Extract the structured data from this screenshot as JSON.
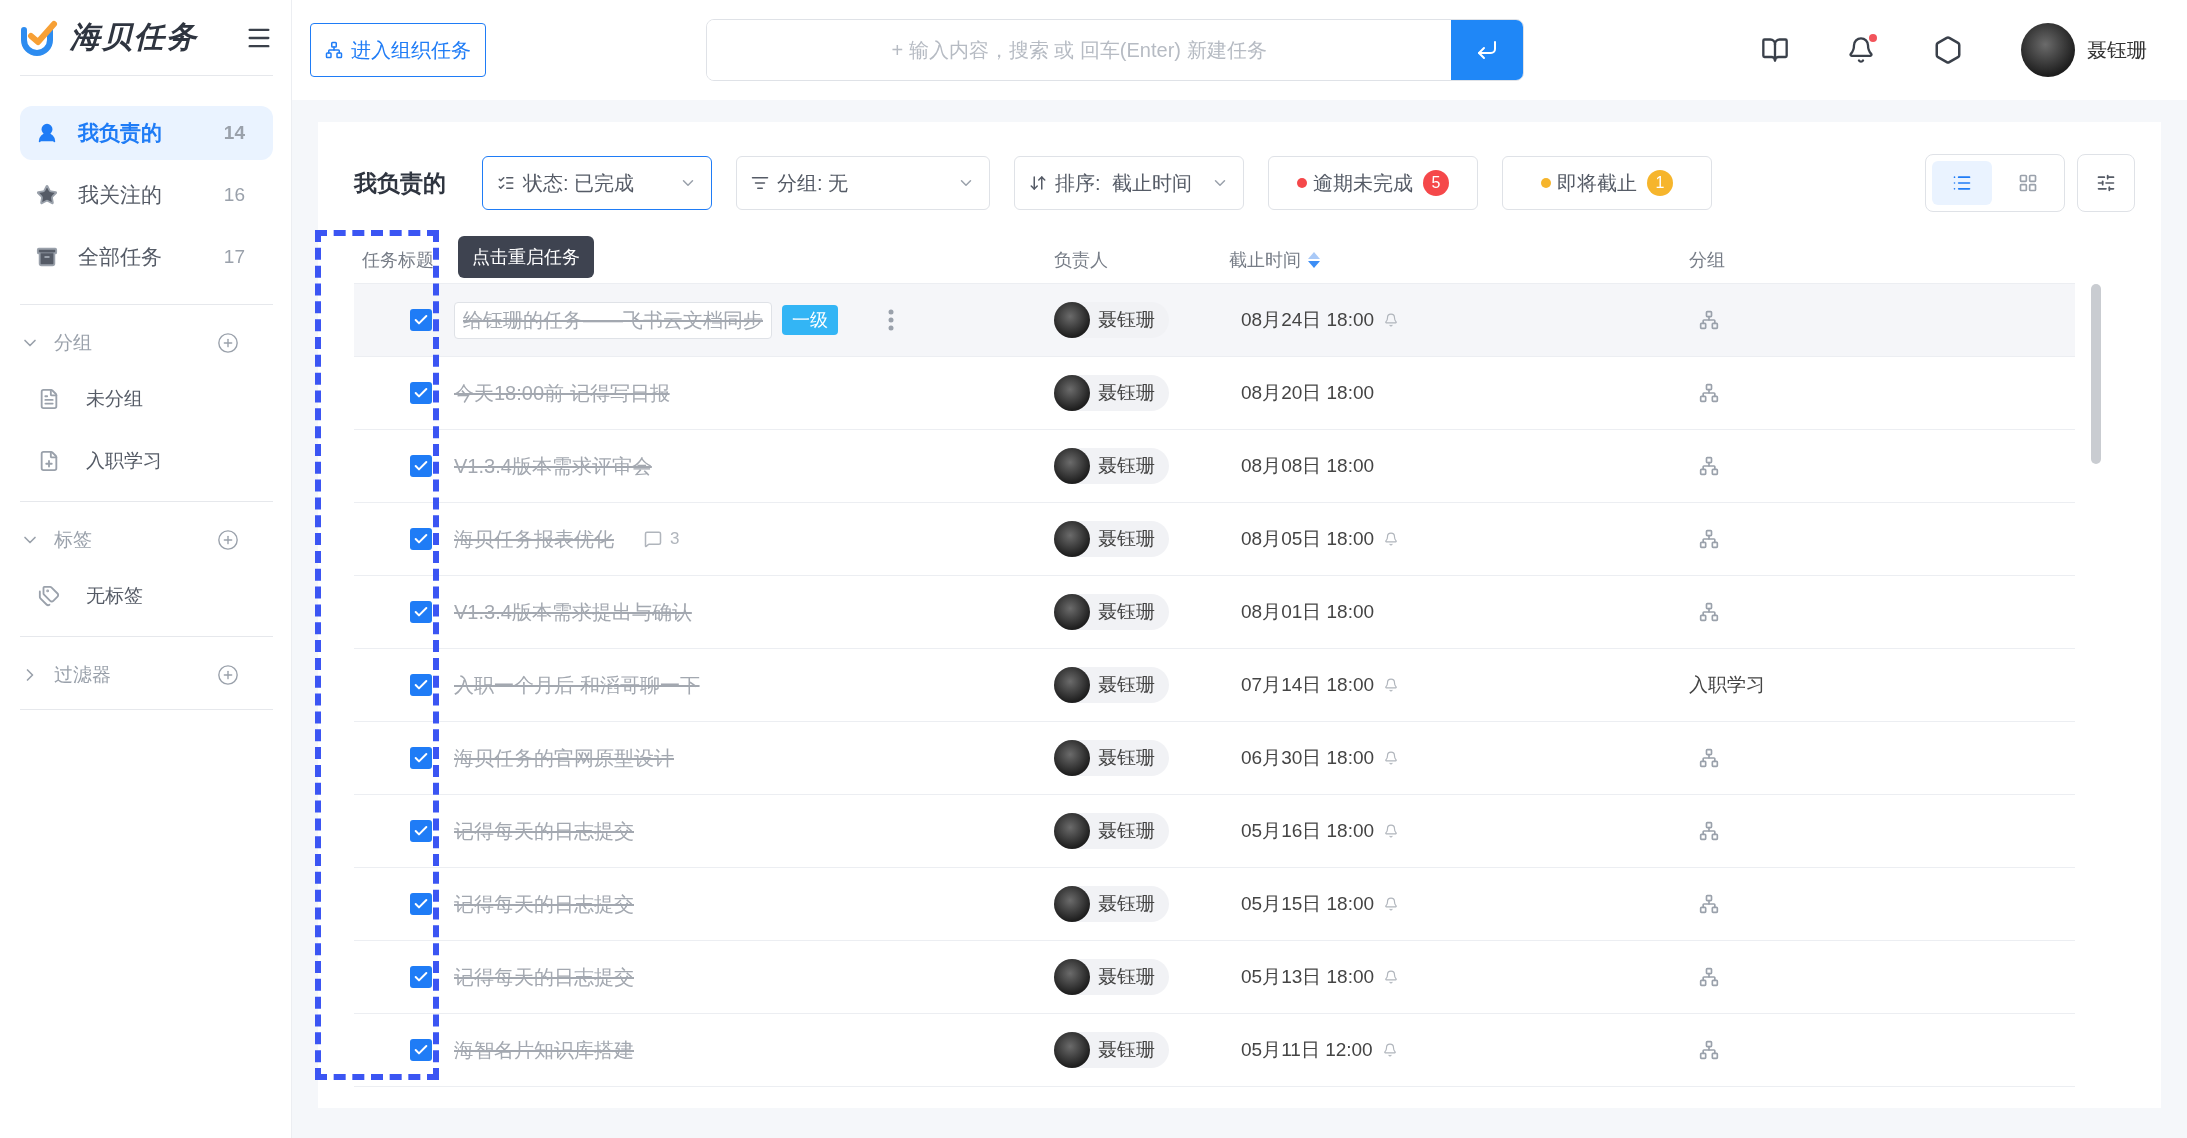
{
  "app": {
    "name": "海贝任务"
  },
  "sidebar": {
    "items": [
      {
        "label": "我负责的",
        "count": "14",
        "selected": true
      },
      {
        "label": "我关注的",
        "count": "16",
        "selected": false
      },
      {
        "label": "全部任务",
        "count": "17",
        "selected": false
      }
    ],
    "sections": [
      {
        "title": "分组",
        "expanded": true,
        "items": [
          "未分组",
          "入职学习"
        ]
      },
      {
        "title": "标签",
        "expanded": true,
        "items": [
          "无标签"
        ]
      },
      {
        "title": "过滤器",
        "expanded": false
      }
    ]
  },
  "topbar": {
    "org_button": "进入组织任务",
    "search": {
      "placeholder": "+ 输入内容，搜索 或 回车(Enter) 新建任务"
    },
    "notification_dot": true,
    "user": {
      "name": "聂钰珊"
    }
  },
  "toolbar": {
    "title": "我负责的",
    "filters": [
      {
        "kind": "status",
        "label": "状态: 已完成",
        "selected": true
      },
      {
        "kind": "group",
        "label": "分组: 无",
        "selected": false
      },
      {
        "kind": "sort",
        "label": "排序:  截止时间",
        "selected": false
      }
    ],
    "badges": [
      {
        "label": "逾期未完成",
        "count": "5",
        "color": "#f5484a"
      },
      {
        "label": "即将截止",
        "count": "1",
        "color": "#f6b52c"
      }
    ],
    "views": [
      {
        "kind": "list",
        "selected": true
      },
      {
        "kind": "grid",
        "selected": false
      }
    ]
  },
  "table": {
    "columns": [
      "任务标题",
      "负责人",
      "截止时间",
      "分组"
    ],
    "tooltip": "点击重启任务",
    "rows": [
      {
        "title": "给钰珊的任务——飞书云文档同步",
        "checked": true,
        "selected": true,
        "priority": "一级",
        "assignee": "聂钰珊",
        "due": "08月24日 18:00",
        "reminder": true
      },
      {
        "title": "今天18:00前 记得写日报",
        "checked": true,
        "selected": false,
        "assignee": "聂钰珊",
        "due": "08月20日 18:00",
        "reminder": false
      },
      {
        "title": "V1.3.4版本需求评审会",
        "checked": true,
        "selected": false,
        "assignee": "聂钰珊",
        "due": "08月08日 18:00",
        "reminder": false
      },
      {
        "title": "海贝任务报表优化",
        "checked": true,
        "selected": false,
        "comments": "3",
        "assignee": "聂钰珊",
        "due": "08月05日 18:00",
        "reminder": true
      },
      {
        "title": "V1.3.4版本需求提出与确认",
        "checked": true,
        "selected": false,
        "assignee": "聂钰珊",
        "due": "08月01日 18:00",
        "reminder": false
      },
      {
        "title": "入职一个月后 和滔哥聊一下",
        "checked": true,
        "selected": false,
        "assignee": "聂钰珊",
        "due": "07月14日 18:00",
        "reminder": true,
        "group": "入职学习"
      },
      {
        "title": "海贝任务的官网原型设计",
        "checked": true,
        "selected": false,
        "assignee": "聂钰珊",
        "due": "06月30日 18:00",
        "reminder": true
      },
      {
        "title": "记得每天的日志提交",
        "checked": true,
        "selected": false,
        "assignee": "聂钰珊",
        "due": "05月16日 18:00",
        "reminder": true
      },
      {
        "title": "记得每天的日志提交",
        "checked": true,
        "selected": false,
        "assignee": "聂钰珊",
        "due": "05月15日 18:00",
        "reminder": true
      },
      {
        "title": "记得每天的日志提交",
        "checked": true,
        "selected": false,
        "assignee": "聂钰珊",
        "due": "05月13日 18:00",
        "reminder": true
      },
      {
        "title": "海智名片知识库搭建",
        "checked": true,
        "selected": false,
        "assignee": "聂钰珊",
        "due": "05月11日 12:00",
        "reminder": true
      }
    ]
  }
}
